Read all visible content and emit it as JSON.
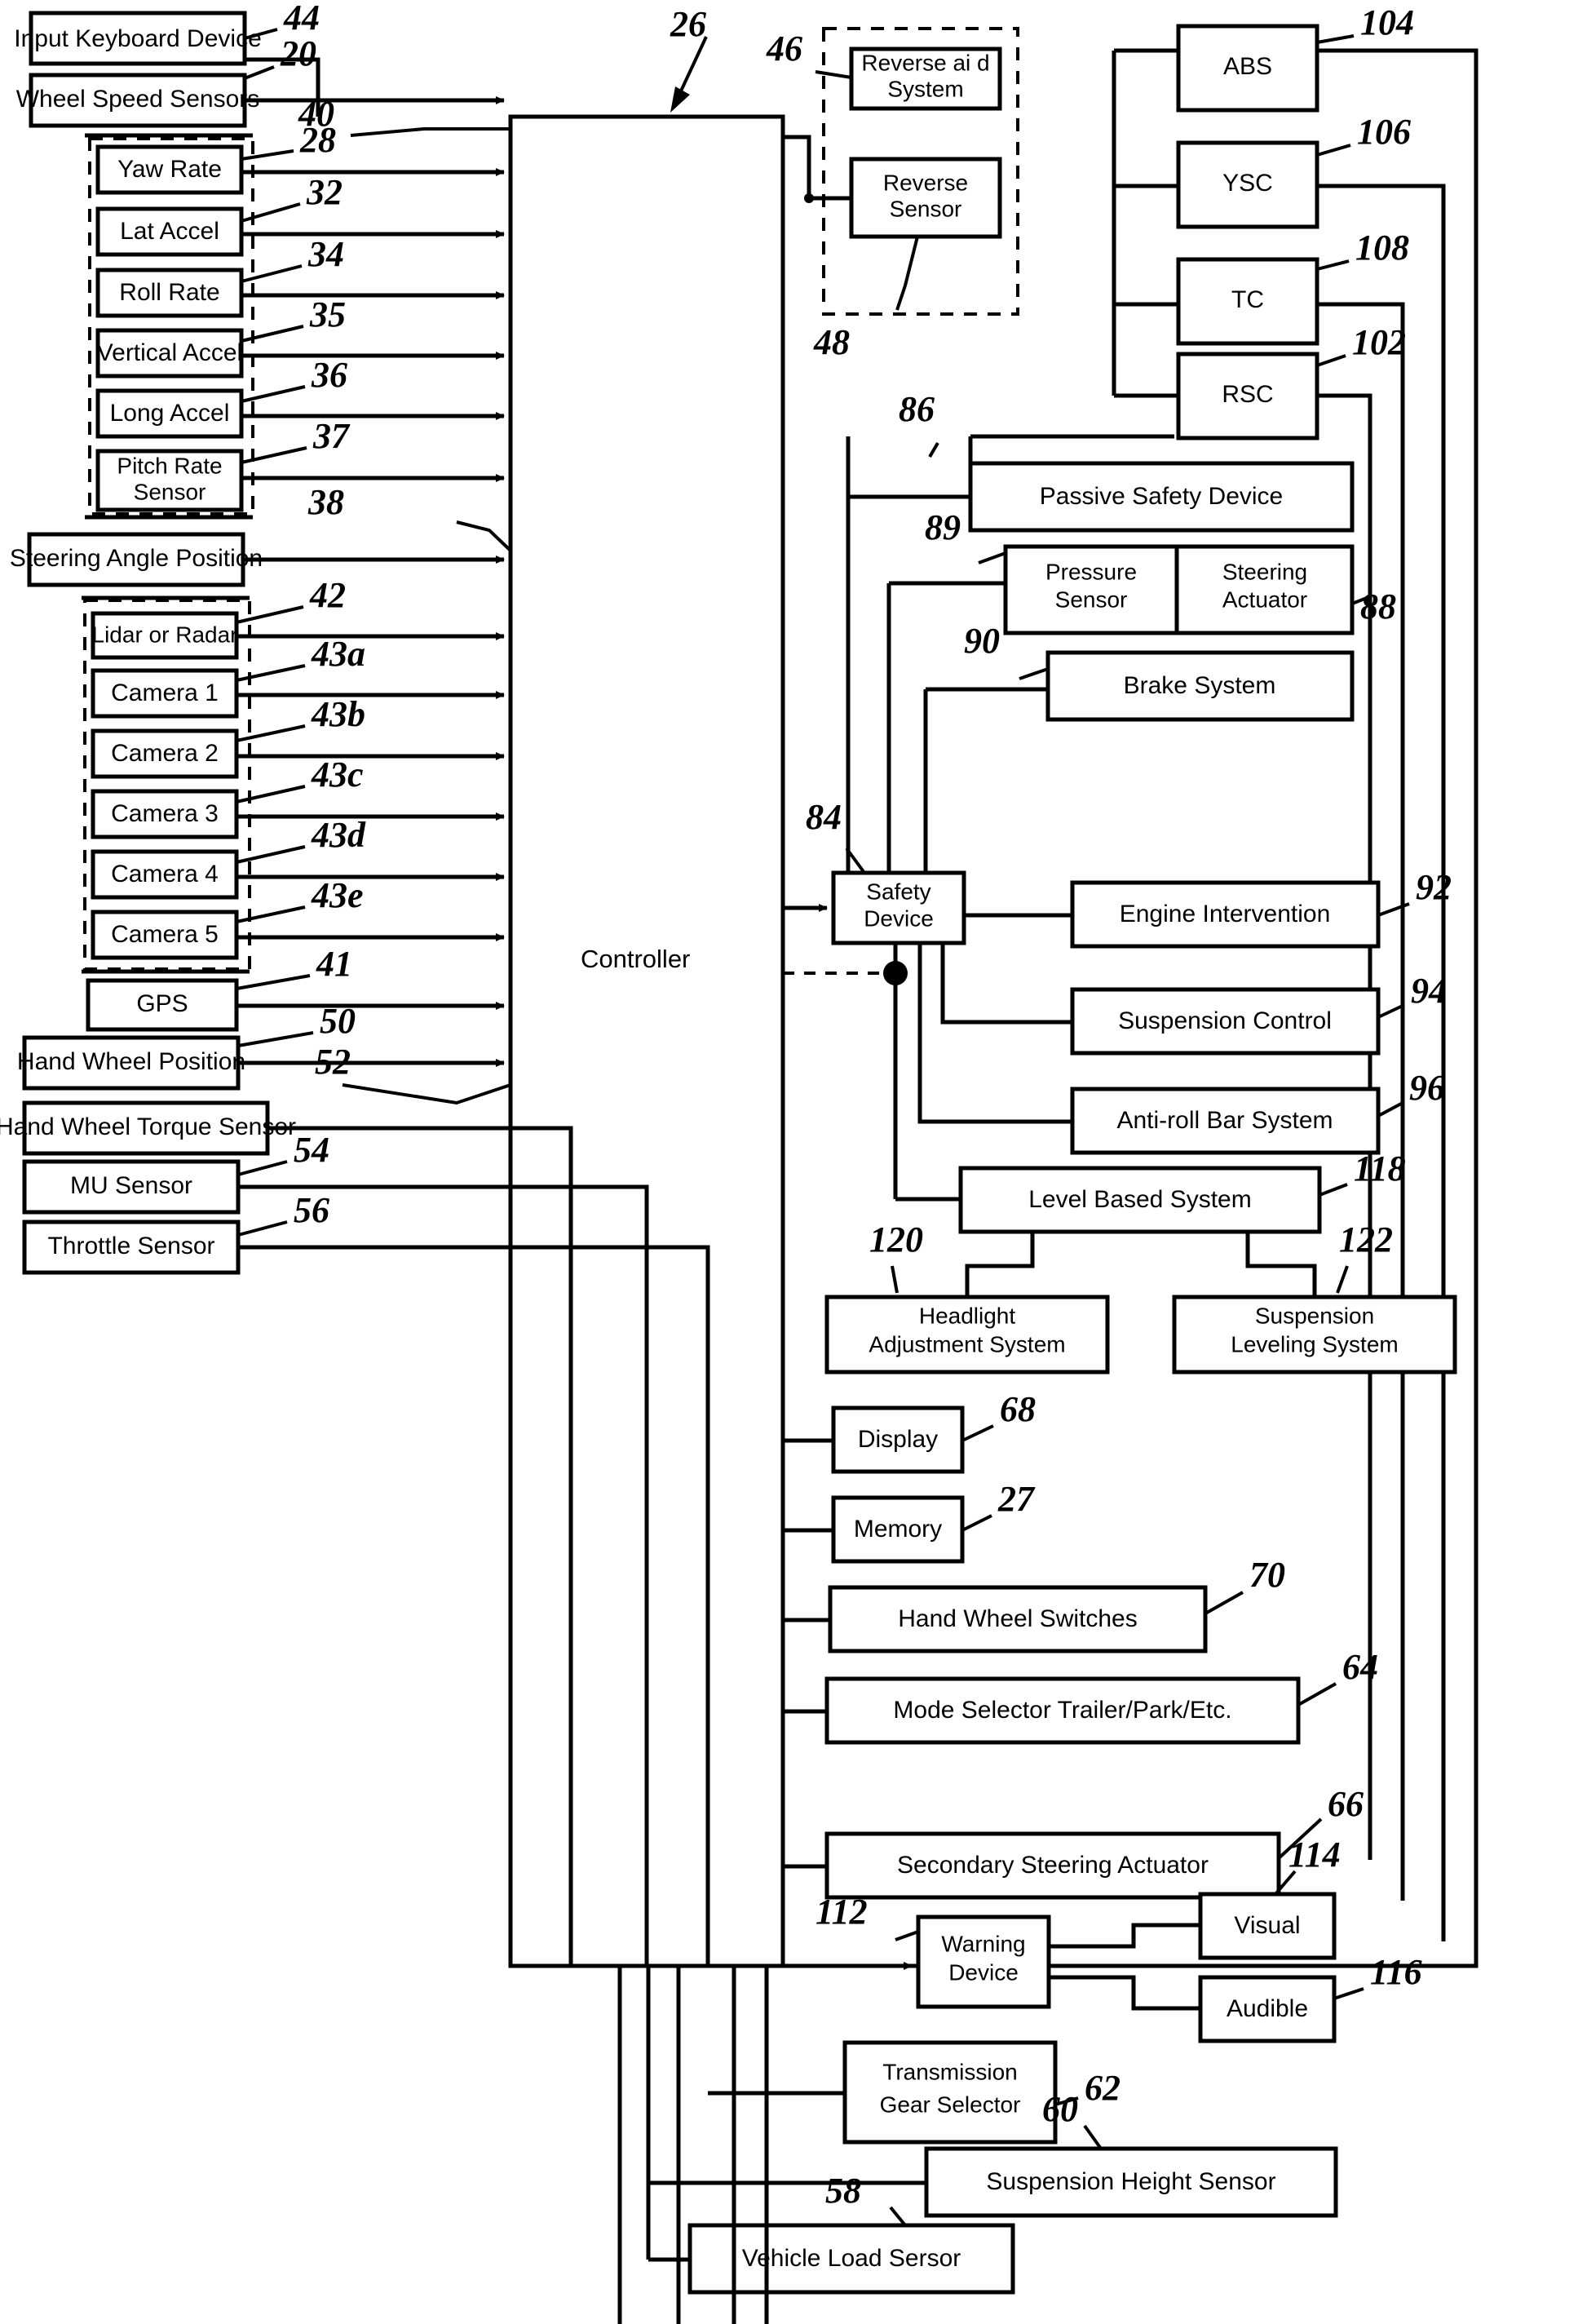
{
  "figure": {
    "type": "patent-block-diagram",
    "overall_ref": "26",
    "controller_label": "Controller",
    "controller_ref": "38"
  },
  "blocks": {
    "input_keyboard_device": "Input Keyboard Device",
    "wheel_speed_sensors": "Wheel Speed Sensors",
    "yaw_rate": "Yaw Rate",
    "lat_accel": "Lat Accel",
    "roll_rate": "Roll Rate",
    "vertical_accel": "Vertical Accel",
    "long_accel": "Long Accel",
    "pitch_rate_sensor_l1": "Pitch Rate",
    "pitch_rate_sensor_l2": "Sensor",
    "steering_angle_position": "Steering Angle Position",
    "lidar_or_radar": "Lidar or Radar",
    "camera_1": "Camera 1",
    "camera_2": "Camera 2",
    "camera_3": "Camera 3",
    "camera_4": "Camera 4",
    "camera_5": "Camera 5",
    "gps": "GPS",
    "hand_wheel_position": "Hand Wheel Position",
    "hand_wheel_torque_sensor": "Hand  Wheel Torque Sensor",
    "mu_sensor": "MU Sensor",
    "throttle_sensor": "Throttle Sensor",
    "reverse_aid_system_l1": "Reverse ai d",
    "reverse_aid_system_l2": "System",
    "reverse_sensor_l1": "Reverse",
    "reverse_sensor_l2": "Sensor",
    "abs": "ABS",
    "ysc": "YSC",
    "tc": "TC",
    "rsc": "RSC",
    "passive_safety_device": "Passive Safety Device",
    "pressure_sensor_l1": "Pressure",
    "pressure_sensor_l2": "Sensor",
    "steering_actuator_l1": "Steering",
    "steering_actuator_l2": "Actuator",
    "brake_system": "Brake System",
    "safety_device_l1": "Safety",
    "safety_device_l2": "Device",
    "engine_intervention": "Engine Intervention",
    "suspension_control": "Suspension Control",
    "anti_roll_bar_system": "Anti-roll Bar System",
    "level_based_system": "Level Based System",
    "headlight_adjustment_system_l1": "Headlight",
    "headlight_adjustment_system_l2": "Adjustment System",
    "suspension_leveling_system_l1": "Suspension",
    "suspension_leveling_system_l2": "Leveling System",
    "display": "Display",
    "memory": "Memory",
    "hand_wheel_switches": "Hand Wheel Switches",
    "mode_selector": "Mode Selector Trailer/Park/Etc.",
    "secondary_steering_actuator": "Secondary Steering Actuator",
    "warning_device_l1": "Warning",
    "warning_device_l2": "Device",
    "visual": "Visual",
    "audible": "Audible",
    "transmission_gear_selector_l1": "Transmission",
    "transmission_gear_selector_l2": "Gear Selector",
    "suspension_height_sensor": "Suspension Height Sensor",
    "vehicle_load_sensor": "Vehicle Load Sersor"
  },
  "refs": {
    "r20": "20",
    "r26": "26",
    "r27": "27",
    "r28": "28",
    "r32": "32",
    "r34": "34",
    "r35": "35",
    "r36": "36",
    "r37": "37",
    "r38": "38",
    "r40": "40",
    "r41": "41",
    "r42": "42",
    "r43a": "43a",
    "r43b": "43b",
    "r43c": "43c",
    "r43d": "43d",
    "r43e": "43e",
    "r44": "44",
    "r46": "46",
    "r48": "48",
    "r50": "50",
    "r52": "52",
    "r54": "54",
    "r56": "56",
    "r58": "58",
    "r60": "60",
    "r62": "62",
    "r64": "64",
    "r66": "66",
    "r68": "68",
    "r70": "70",
    "r84": "84",
    "r86": "86",
    "r88": "88",
    "r89": "89",
    "r90": "90",
    "r92": "92",
    "r94": "94",
    "r96": "96",
    "r102": "102",
    "r104": "104",
    "r106": "106",
    "r108": "108",
    "r112": "112",
    "r114": "114",
    "r116": "116",
    "r118": "118",
    "r120": "120",
    "r122": "122"
  },
  "colors": {
    "ink": "#000000",
    "paper": "#ffffff"
  }
}
